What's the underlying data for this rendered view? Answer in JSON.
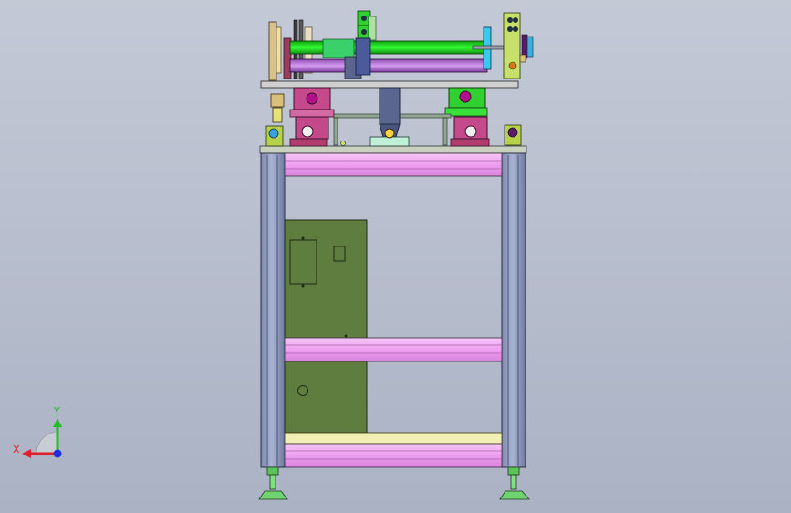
{
  "viewport": {
    "background_top": "#c4c9d6",
    "background_bottom": "#aab2c4"
  },
  "colors": {
    "frame_post": "#8a95b8",
    "pink_rail": "#ee9ff0",
    "cabinet": "#5f7d3e",
    "green_roller": "#22e022",
    "purple_roller": "#b96fd9",
    "bearing_block": "#c44a8c",
    "bearing_base": "#b03d6e",
    "cream_bar": "#f1efb3",
    "foot": "#6fd46f"
  },
  "triad": {
    "x_label": "X",
    "y_label": "Y",
    "x_color": "#e0202a",
    "y_color": "#20c020",
    "z_color": "#2030e0"
  }
}
